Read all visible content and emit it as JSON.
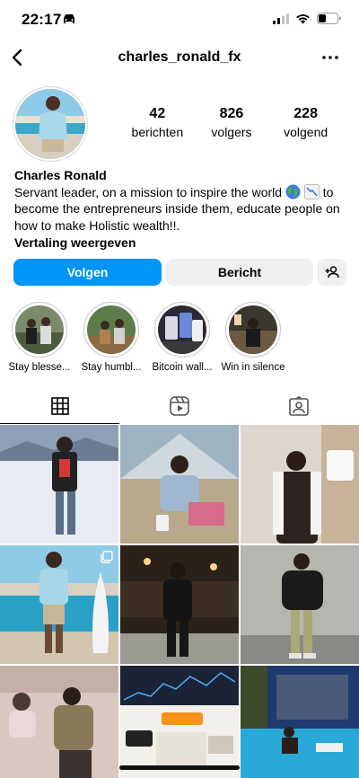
{
  "status_bar": {
    "time": "22:17"
  },
  "nav": {
    "username": "charles_ronald_fx"
  },
  "stats": [
    {
      "value": "42",
      "label": "berichten"
    },
    {
      "value": "826",
      "label": "volgers"
    },
    {
      "value": "228",
      "label": "volgend"
    }
  ],
  "bio": {
    "name": "Charles Ronald",
    "text_part1": "Servant leader, on a mission to inspire the world",
    "text_part2": "to become the entrepreneurs inside them, educate people on how to make Holistic wealth!!.",
    "translate": "Vertaling weergeven"
  },
  "actions": {
    "follow": "Volgen",
    "message": "Bericht"
  },
  "highlights": [
    {
      "label": "Stay blesse..."
    },
    {
      "label": "Stay humbl..."
    },
    {
      "label": "Bitcoin wall..."
    },
    {
      "label": "Win in silence"
    }
  ],
  "icons": {
    "back": "chevron-left-icon",
    "more": "more-horizontal-icon",
    "grid_tab": "grid-icon",
    "reels_tab": "reels-icon",
    "tagged_tab": "tagged-icon",
    "add_user": "add-user-icon"
  },
  "colors": {
    "primary_button": "#0095f6",
    "secondary_button": "#efefef"
  }
}
